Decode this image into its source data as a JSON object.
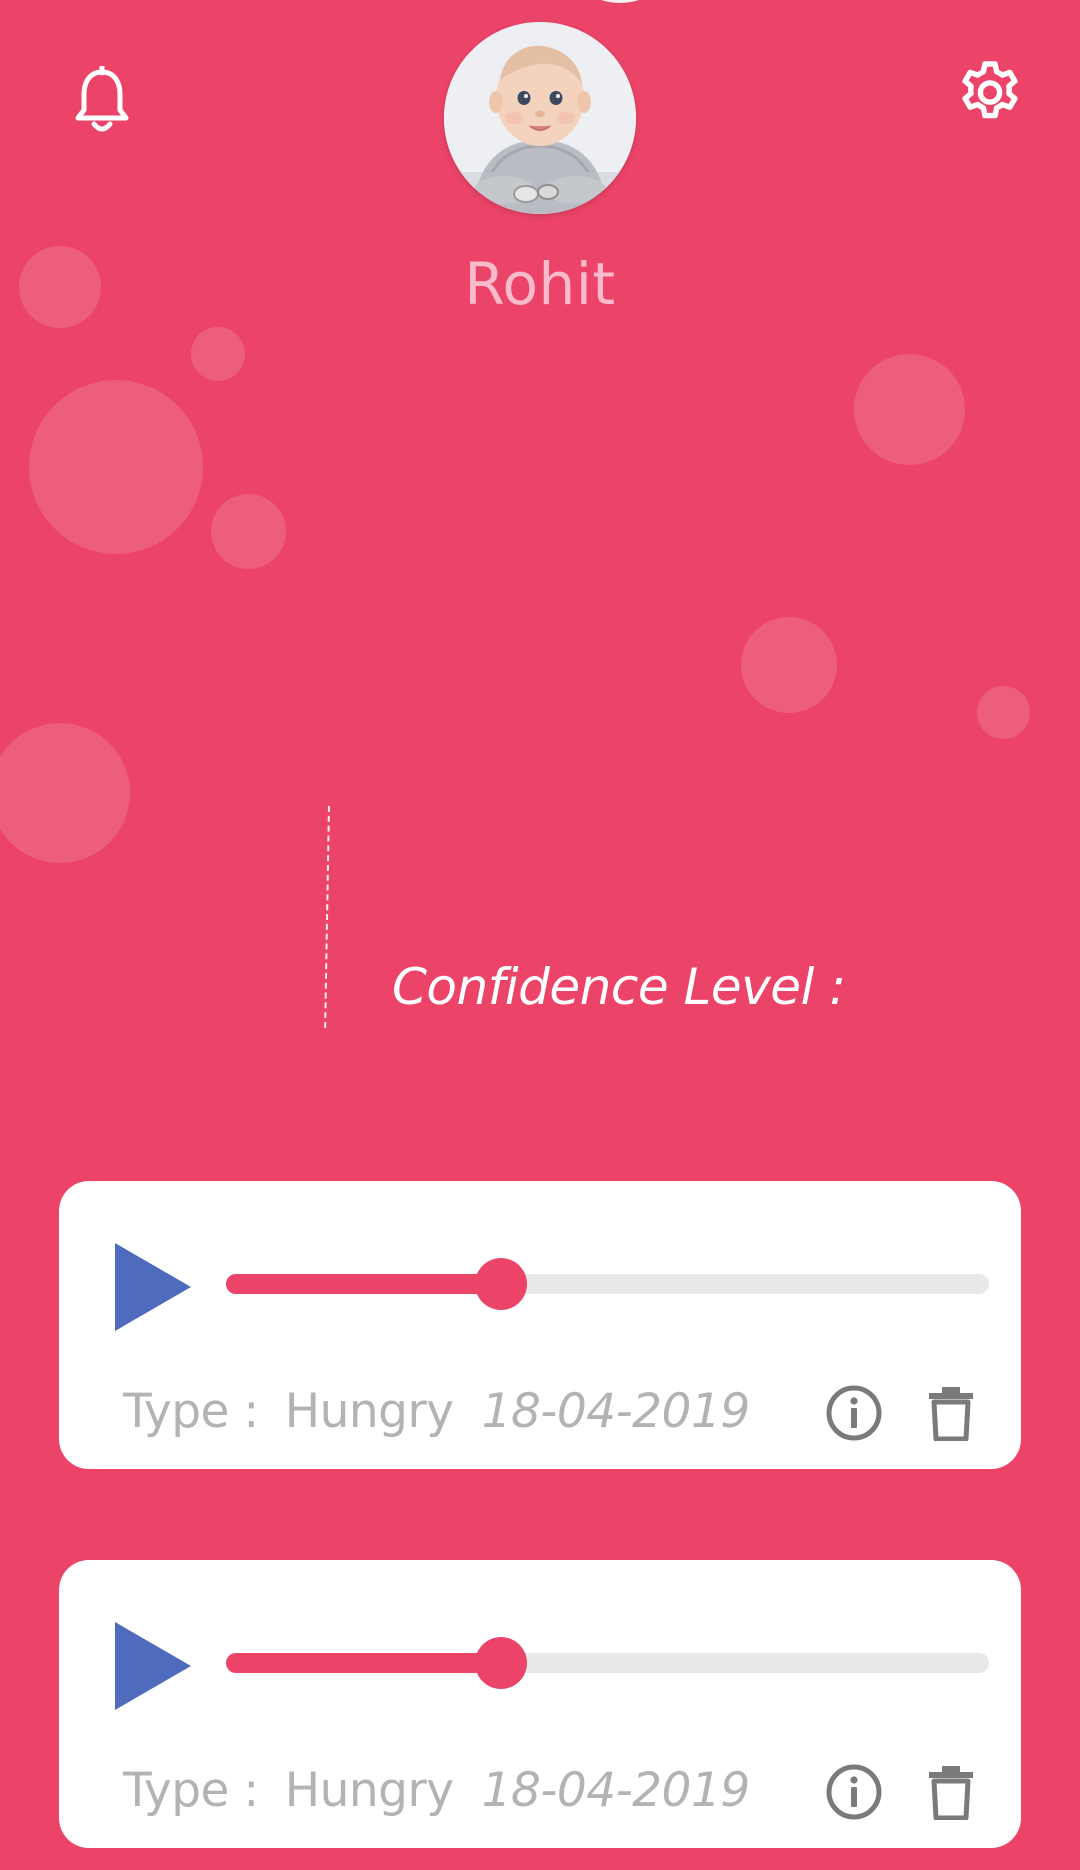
{
  "header": {
    "notification_icon": "bell-icon",
    "settings_icon": "gear-icon",
    "avatar": "baby-photo"
  },
  "profile": {
    "name": "Rohit"
  },
  "confidence": {
    "label": "Confidence Level :"
  },
  "recordings": [
    {
      "type_label": "Type :",
      "type_value": "Hungry",
      "date": "18-04-2019",
      "progress": 0.36,
      "play_icon": "play-icon",
      "info_icon": "info-icon",
      "delete_icon": "trash-icon"
    },
    {
      "type_label": "Type :",
      "type_value": "Hungry",
      "date": "18-04-2019",
      "progress": 0.36,
      "play_icon": "play-icon",
      "info_icon": "info-icon",
      "delete_icon": "trash-icon"
    }
  ],
  "colors": {
    "background": "#EB4468",
    "accent": "#EB4468",
    "play": "#4E6BBE",
    "track": "#E8E8E8",
    "muted_text": "#B3B3B3",
    "name_text": "#F8BBCB"
  }
}
